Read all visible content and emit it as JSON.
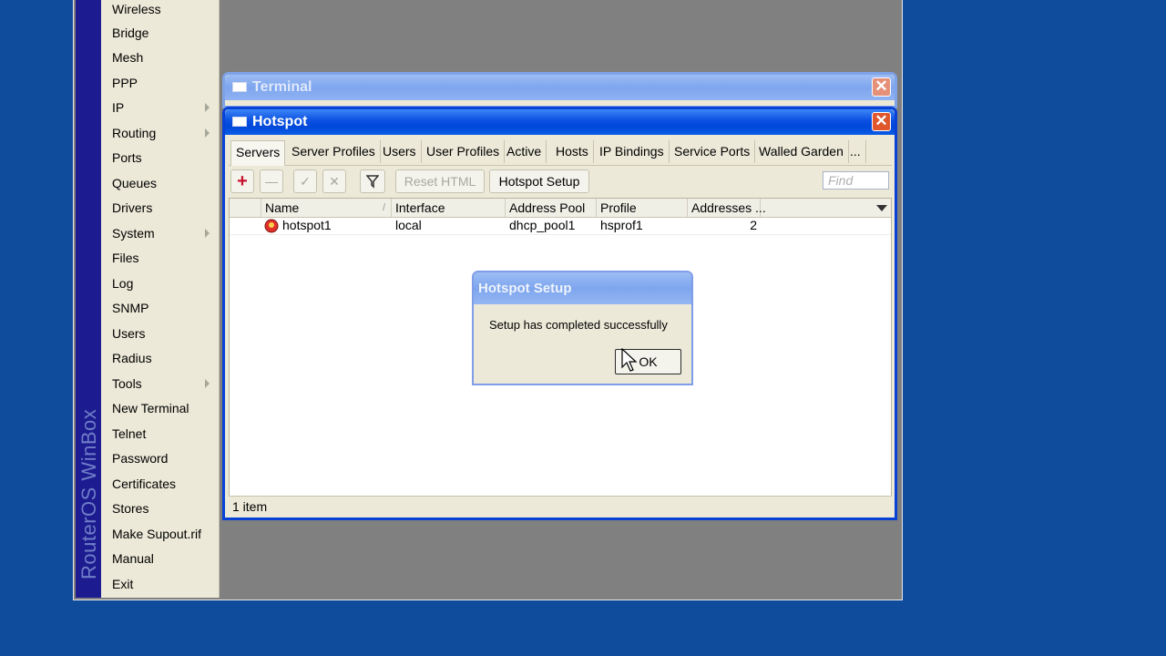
{
  "branding": {
    "text": "RouterOS WinBox"
  },
  "sidebar": {
    "items": [
      {
        "label": "Wireless",
        "submenu": false
      },
      {
        "label": "Bridge",
        "submenu": false
      },
      {
        "label": "Mesh",
        "submenu": false
      },
      {
        "label": "PPP",
        "submenu": false
      },
      {
        "label": "IP",
        "submenu": true
      },
      {
        "label": "Routing",
        "submenu": true
      },
      {
        "label": "Ports",
        "submenu": false
      },
      {
        "label": "Queues",
        "submenu": false
      },
      {
        "label": "Drivers",
        "submenu": false
      },
      {
        "label": "System",
        "submenu": true
      },
      {
        "label": "Files",
        "submenu": false
      },
      {
        "label": "Log",
        "submenu": false
      },
      {
        "label": "SNMP",
        "submenu": false
      },
      {
        "label": "Users",
        "submenu": false
      },
      {
        "label": "Radius",
        "submenu": false
      },
      {
        "label": "Tools",
        "submenu": true
      },
      {
        "label": "New Terminal",
        "submenu": false
      },
      {
        "label": "Telnet",
        "submenu": false
      },
      {
        "label": "Password",
        "submenu": false
      },
      {
        "label": "Certificates",
        "submenu": false
      },
      {
        "label": "Stores",
        "submenu": false
      },
      {
        "label": "Make Supout.rif",
        "submenu": false
      },
      {
        "label": "Manual",
        "submenu": false
      },
      {
        "label": "Exit",
        "submenu": false
      }
    ]
  },
  "terminal_window": {
    "title": "Terminal"
  },
  "hotspot_window": {
    "title": "Hotspot",
    "tabs": [
      "Servers",
      "Server Profiles",
      "Users",
      "User Profiles",
      "Active",
      "Hosts",
      "IP Bindings",
      "Service Ports",
      "Walled Garden",
      "..."
    ],
    "active_tab": "Servers",
    "toolbar": {
      "reset_html": "Reset HTML",
      "hotspot_setup": "Hotspot Setup",
      "find_placeholder": "Find"
    },
    "columns": [
      "Name",
      "Interface",
      "Address Pool",
      "Profile",
      "Addresses ..."
    ],
    "rows": [
      {
        "name": "hotspot1",
        "interface": "local",
        "address_pool": "dhcp_pool1",
        "profile": "hsprof1",
        "addresses": "2"
      }
    ],
    "status": "1 item"
  },
  "dialog": {
    "title": "Hotspot Setup",
    "message": "Setup has completed successfully",
    "ok_label": "OK"
  },
  "colors": {
    "desktop": "#0f4c9c",
    "titlebar": "#0a4fe0",
    "brand_strip": "#1c1b8f"
  }
}
